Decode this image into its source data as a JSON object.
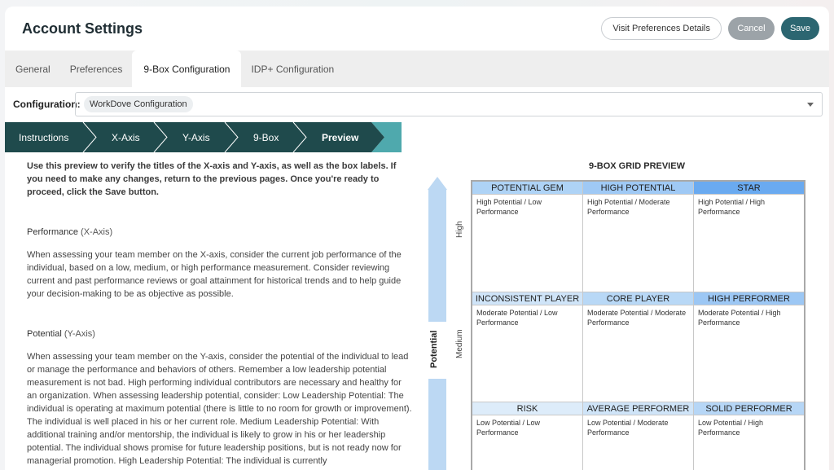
{
  "header": {
    "title": "Account Settings",
    "visit_label": "Visit Preferences Details",
    "cancel_label": "Cancel",
    "save_label": "Save"
  },
  "tabs": [
    {
      "label": "General",
      "active": false
    },
    {
      "label": "Preferences",
      "active": false
    },
    {
      "label": "9-Box Configuration",
      "active": true
    },
    {
      "label": "IDP+ Configuration",
      "active": false
    }
  ],
  "configuration": {
    "label": "Configuration:",
    "value": "WorkDove Configuration"
  },
  "steps": [
    {
      "label": "Instructions",
      "bold": false
    },
    {
      "label": "X-Axis",
      "bold": false
    },
    {
      "label": "Y-Axis",
      "bold": false
    },
    {
      "label": "9-Box",
      "bold": false
    },
    {
      "label": "Preview",
      "bold": true
    }
  ],
  "content": {
    "intro": "Use this preview to verify the titles of the X-axis and Y-axis, as well as the box labels. If you need to make any changes, return to the previous pages. Once you're ready to proceed, click the Save button.",
    "performance_title": "Performance",
    "performance_axis": "(X-Axis)",
    "performance_text": "When assessing your team member on the X-axis, consider the current job performance of the individual, based on a low, medium, or high performance measurement. Consider reviewing current and past performance reviews or goal attainment for historical trends and to help guide your decision-making to be as objective as possible.",
    "potential_title": "Potential",
    "potential_axis": "(Y-Axis)",
    "potential_text": "When assessing your team member on the Y-axis, consider the potential of the individual to lead or manage the performance and behaviors of others. Remember a low leadership potential measurement is not bad. High performing individual contributors are necessary and healthy for an organization. When assessing leadership potential, consider: Low Leadership Potential: The individual is operating at maximum potential (there is little to no room for growth or improvement). The individual is well placed in his or her current role. Medium Leadership Potential: With additional training and/or mentorship, the individual is likely to grow in his or her leadership potential. The individual shows promise for future leadership positions, but is not ready now for managerial promotion. High Leadership Potential: The individual is currently"
  },
  "preview": {
    "title": "9-BOX GRID PREVIEW",
    "y_axis_label": "Potential",
    "levels": [
      "High",
      "Medium"
    ],
    "cells": [
      {
        "title": "POTENTIAL GEM",
        "desc": "High Potential / Low Performance",
        "color": "#aed3f6"
      },
      {
        "title": "HIGH POTENTIAL",
        "desc": "High Potential / Moderate Performance",
        "color": "#9fc9f5"
      },
      {
        "title": "STAR",
        "desc": "High Potential / High Performance",
        "color": "#6aaaf0"
      },
      {
        "title": "INCONSISTENT PLAYER",
        "desc": "Moderate Potential / Low Performance",
        "color": "#cfe4f8"
      },
      {
        "title": "CORE PLAYER",
        "desc": "Moderate Potential / Moderate Performance",
        "color": "#b8d8f6"
      },
      {
        "title": "HIGH PERFORMER",
        "desc": "Moderate Potential / High Performance",
        "color": "#9cc7f4"
      },
      {
        "title": "RISK",
        "desc": "Low Potential / Low Performance",
        "color": "#ddecfa"
      },
      {
        "title": "AVERAGE PERFORMER",
        "desc": "Low Potential / Moderate Performance",
        "color": "#cfe4f8"
      },
      {
        "title": "SOLID PERFORMER",
        "desc": "Low Potential / High Performance",
        "color": "#b6d6f6"
      }
    ]
  },
  "colors": {
    "step_dark": "#1f4a4c",
    "step_accent": "#4fa9ad",
    "save": "#2c6671",
    "arrow": "#bcd8f3"
  }
}
